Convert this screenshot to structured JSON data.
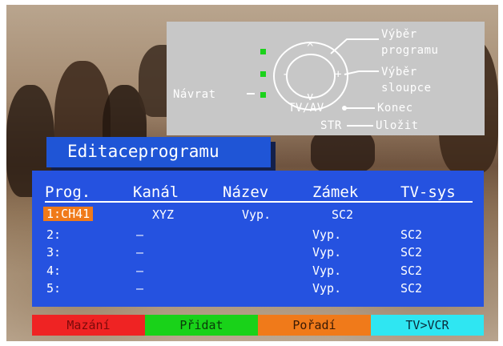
{
  "help": {
    "vyber_programu_1": "Výběr",
    "vyber_programu_2": "programu",
    "vyber_sloupce_1": "Výběr",
    "vyber_sloupce_2": "sloupce",
    "konec": "Konec",
    "ulozit": "Uložit",
    "navrat": "Návrat",
    "tv_av": "TV/AV",
    "str": "STR",
    "up": "^",
    "down": "v",
    "minus": "-",
    "plus": "+"
  },
  "title": "Editaceprogramu",
  "table": {
    "headers": [
      "Prog.",
      "Kanál",
      "Název",
      "Zámek",
      "TV-sys"
    ],
    "rows": [
      [
        "1:CH41",
        "XYZ",
        "Vyp.",
        "SC2",
        ""
      ],
      [
        "2:",
        "–",
        "",
        "Vyp.",
        "SC2"
      ],
      [
        "3:",
        "–",
        "",
        "Vyp.",
        "SC2"
      ],
      [
        "4:",
        "–",
        "",
        "Vyp.",
        "SC2"
      ],
      [
        "5:",
        "–",
        "",
        "Vyp.",
        "SC2"
      ]
    ]
  },
  "buttons": {
    "red": "Mazání",
    "green": "Přidat",
    "orange": "Pořadí",
    "cyan": "TV>VCR"
  },
  "colors": {
    "panel": "#2552e0",
    "selected": "#f07a1a",
    "red": "#ef2323",
    "green": "#19d219",
    "orange": "#f07a1a",
    "cyan": "#2fe6f2"
  }
}
